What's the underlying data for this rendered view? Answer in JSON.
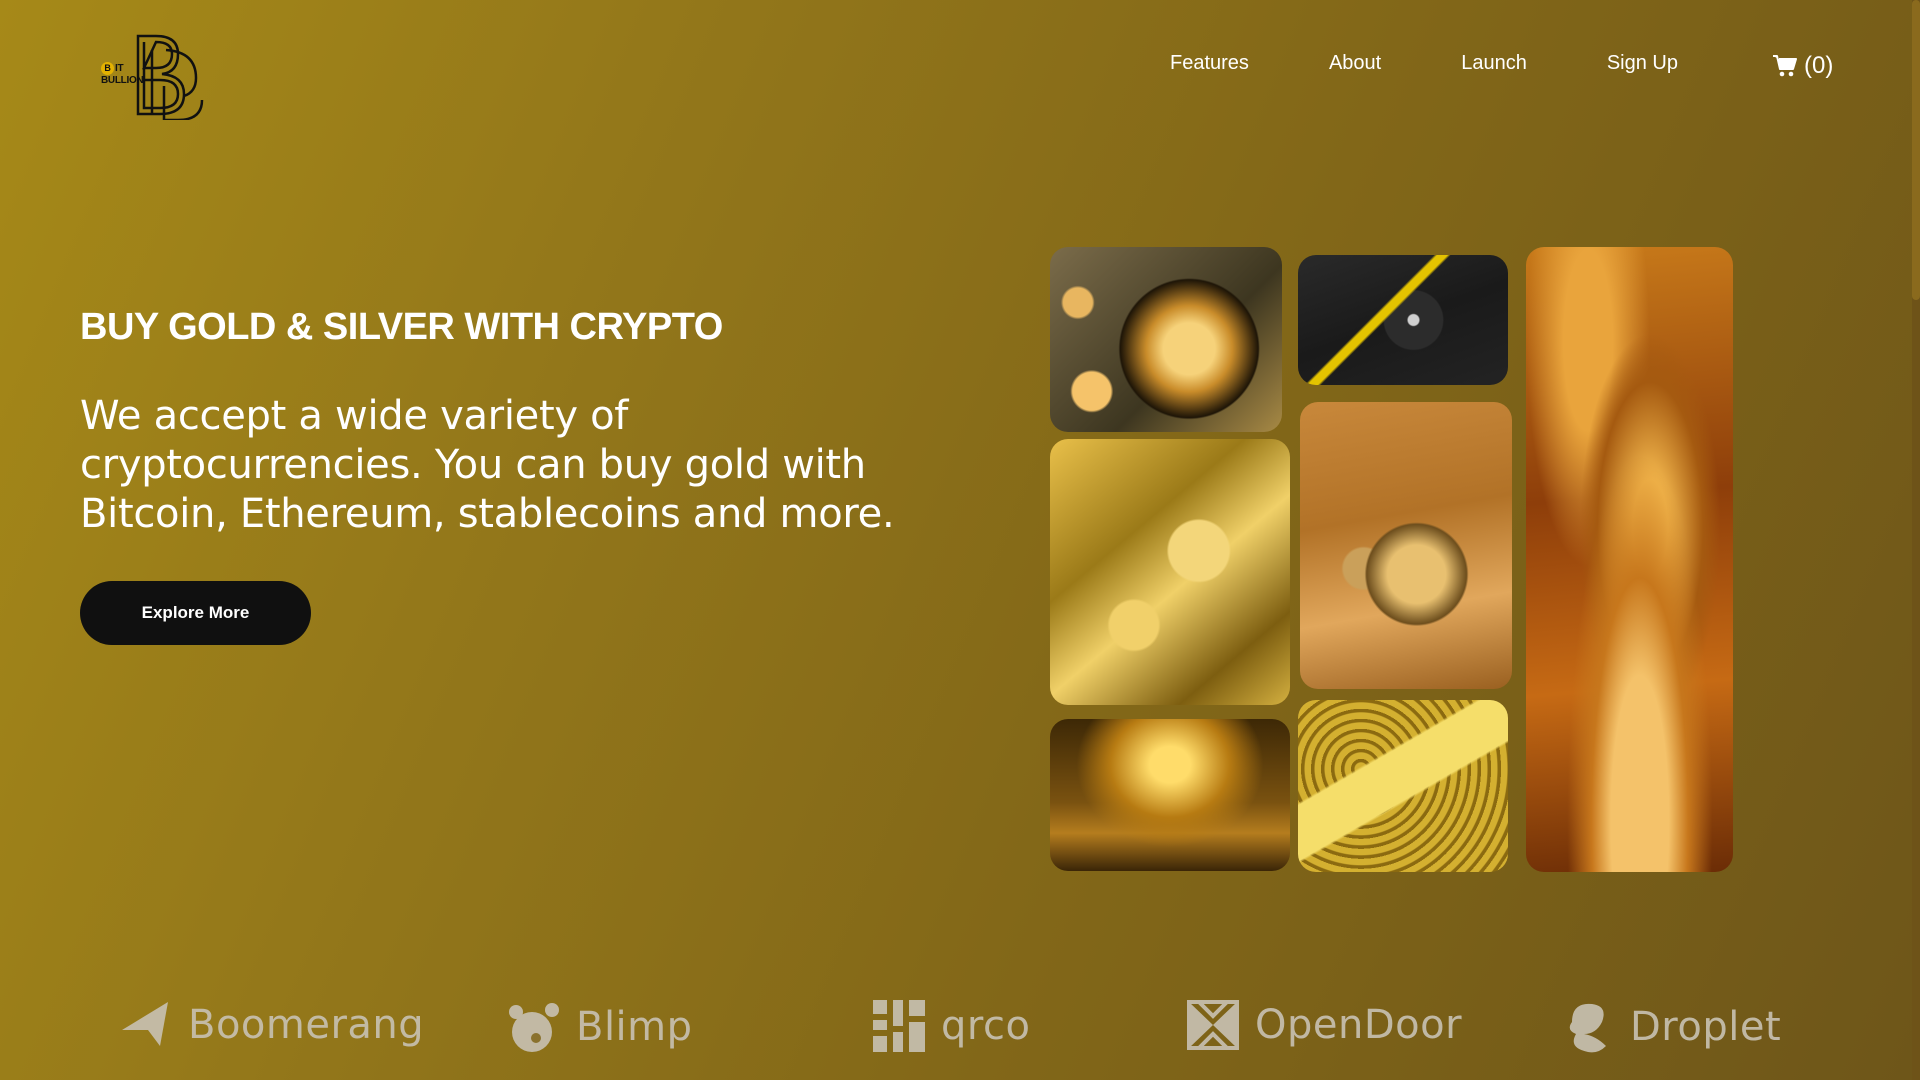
{
  "logo": {
    "line1": "IT",
    "line2": "BULLION",
    "coin": "B"
  },
  "nav": {
    "items": [
      "Features",
      "About",
      "Launch",
      "Sign Up"
    ]
  },
  "cart": {
    "count_label": "(0)"
  },
  "hero": {
    "eyebrow": "BUY GOLD & SILVER WITH CRYPTO",
    "lead": "We accept a wide variety of cryptocurrencies. You can buy gold with Bitcoin, Ethereum, stablecoins and more.",
    "cta": "Explore More"
  },
  "brands": [
    "Boomerang",
    "Blimp",
    "qrco",
    "OpenDoor",
    "Droplet"
  ],
  "colors": {
    "background_start": "#a68918",
    "background_end": "#6e5619",
    "cta": "#101010",
    "brand_text": "#c7c0b0"
  },
  "icons": {
    "cart": "cart-icon"
  }
}
